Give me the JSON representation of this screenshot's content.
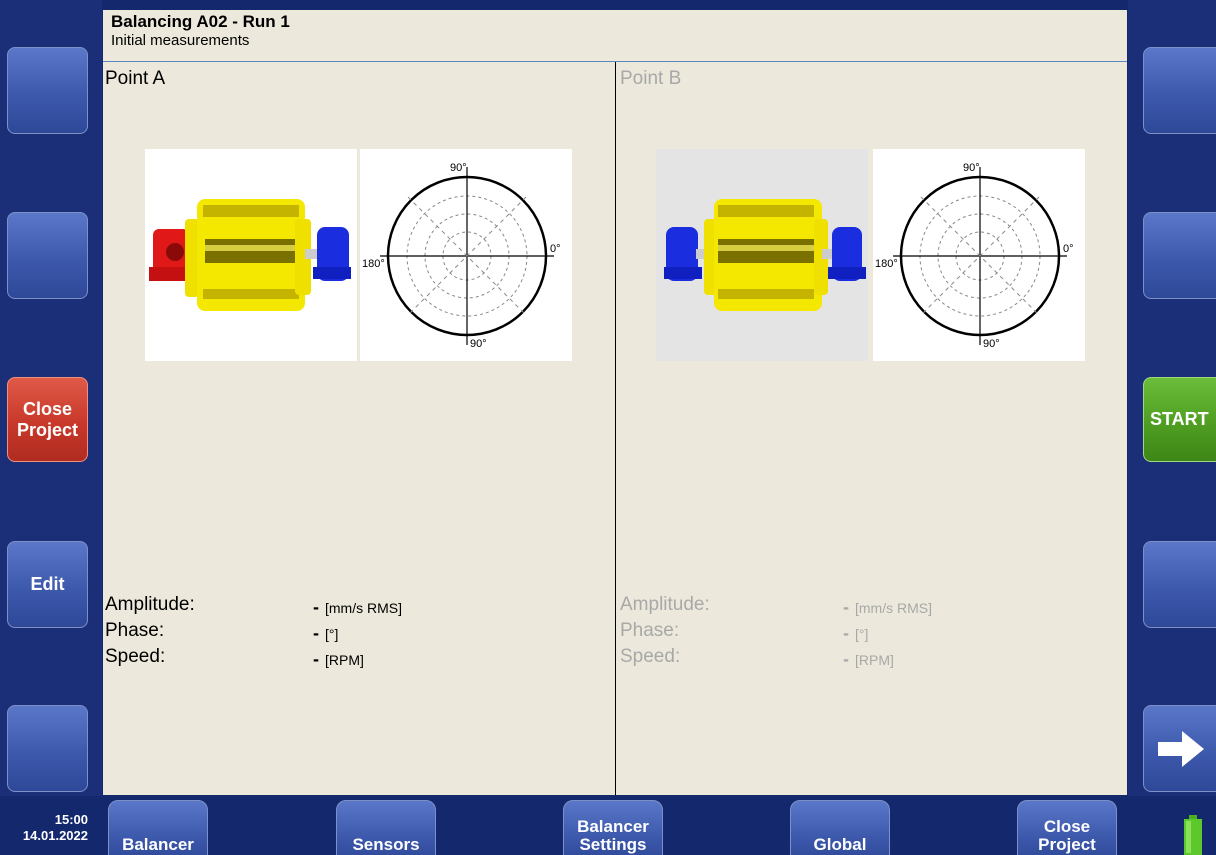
{
  "header": {
    "title": "Balancing A02 - Run 1",
    "subtitle": "Initial measurements"
  },
  "left_buttons": [
    {
      "label": ""
    },
    {
      "label": ""
    },
    {
      "label": "Close\nProject",
      "color": "#c8382a"
    },
    {
      "label": "Edit"
    },
    {
      "label": ""
    }
  ],
  "right_buttons": [
    {
      "label": ""
    },
    {
      "label": ""
    },
    {
      "label": "START",
      "color": "#4f9e22"
    },
    {
      "label": ""
    },
    {
      "icon": "arrow-right-icon"
    }
  ],
  "point_a": {
    "label": "Point A",
    "polar": {
      "top": "90°",
      "bottom": "90°",
      "left": "180°",
      "right": "0°"
    },
    "measurements": [
      {
        "name": "Amplitude:",
        "value": "-",
        "unit": "[mm/s RMS]"
      },
      {
        "name": "Phase:",
        "value": "-",
        "unit": "[°]"
      },
      {
        "name": "Speed:",
        "value": "-",
        "unit": "[RPM]"
      }
    ]
  },
  "point_b": {
    "label": "Point B",
    "polar": {
      "top": "90°",
      "bottom": "90°",
      "left": "180°",
      "right": "0°"
    },
    "measurements": [
      {
        "name": "Amplitude:",
        "value": "-",
        "unit": "[mm/s RMS]"
      },
      {
        "name": "Phase:",
        "value": "-",
        "unit": "[°]"
      },
      {
        "name": "Speed:",
        "value": "-",
        "unit": "[RPM]"
      }
    ]
  },
  "bottom_tabs": [
    {
      "label": "Balancer"
    },
    {
      "label": "Sensors"
    },
    {
      "label": "Balancer\nSettings"
    },
    {
      "label": "Global"
    },
    {
      "label": "Close\nProject"
    }
  ],
  "status": {
    "time": "15:00",
    "date": "14.01.2022"
  },
  "colors": {
    "panel": "#ece9dc",
    "rail": "#1a2f78",
    "button_blue": "#3d59ac",
    "disabled_text": "#a8a8a8"
  }
}
